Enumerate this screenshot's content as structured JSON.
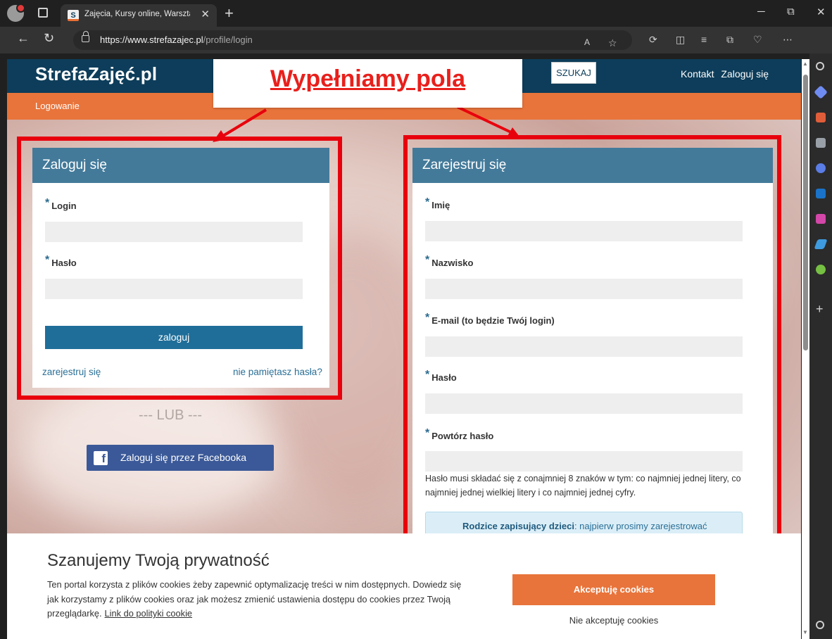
{
  "browser": {
    "tab_title": "Zajęcia, Kursy online, Warsztaty, K",
    "tab_close": "✕",
    "new_tab": "+",
    "url_domain": "https://www.strefazajec.pl",
    "url_path": "/profile/login",
    "win_min": "─",
    "win_max": "⧉",
    "win_close": "✕",
    "back": "←",
    "reload": "↻",
    "more": "⋯"
  },
  "site": {
    "logo": "StrefaZajęć.pl",
    "search_button": "SZUKAJ",
    "nav": [
      "Kontakt",
      "Zaloguj się"
    ],
    "breadcrumb": "Logowanie"
  },
  "annotation": {
    "callout": "Wypełniamy pola"
  },
  "login_panel": {
    "title": "Zaloguj się",
    "fields": [
      {
        "label": "Login",
        "value": ""
      },
      {
        "label": "Hasło",
        "value": ""
      }
    ],
    "submit": "zaloguj",
    "register_link": "zarejestruj się",
    "forgot_link": "nie pamiętasz hasła?"
  },
  "alternative": {
    "separator": "--- LUB ---",
    "facebook_button": "Zaloguj się przez Facebooka",
    "facebook_icon": "f"
  },
  "register_panel": {
    "title": "Zarejestruj się",
    "fields": [
      {
        "label": "Imię",
        "value": ""
      },
      {
        "label": "Nazwisko",
        "value": ""
      },
      {
        "label": "E-mail (to będzie Twój login)",
        "value": ""
      },
      {
        "label": "Hasło",
        "value": ""
      },
      {
        "label": "Powtórz hasło",
        "value": ""
      }
    ],
    "password_hint": "Hasło musi składać się z conajmniej 8 znaków w tym: co najmniej jednej litery, co najmniej jednej wielkiej litery i co najmniej jednej cyfry.",
    "info_bold": "Rodzice zapisujący dzieci",
    "info_rest": ": najpierw prosimy zarejestrować"
  },
  "cookie": {
    "title": "Szanujemy Twoją prywatność",
    "text": "Ten portal korzysta z plików cookies żeby zapewnić optymalizację treści w nim dostępnych. Dowiedz się jak korzystamy z plików cookies oraz jak możesz zmienić ustawienia dostępu do cookies przez Twoją przeglądarkę.",
    "policy_link": "Link do polityki cookie",
    "accept": "Akceptuję cookies",
    "reject": "Nie akceptuję cookies"
  },
  "colors": {
    "header_navy": "#0d3d5a",
    "accent_orange": "#e8743b",
    "panel_head": "#437a9a",
    "button_blue": "#1f6e99",
    "annotation_red": "#e8000d",
    "facebook": "#3b5998"
  }
}
